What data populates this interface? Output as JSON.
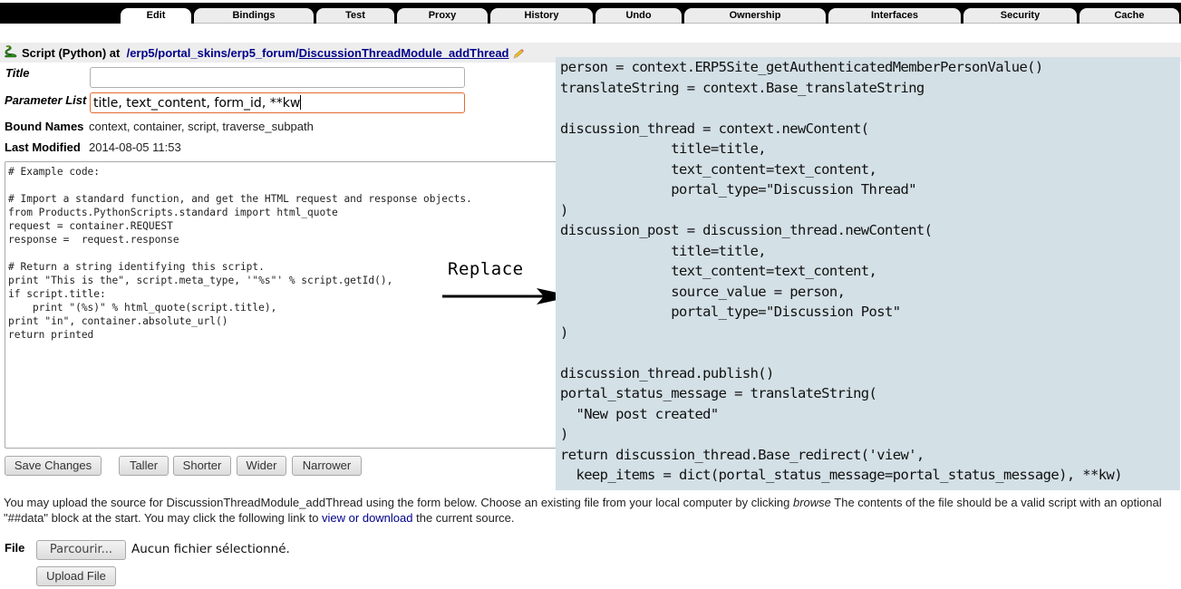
{
  "tabs": [
    {
      "label": "Edit",
      "active": true
    },
    {
      "label": "Bindings"
    },
    {
      "label": "Test"
    },
    {
      "label": "Proxy"
    },
    {
      "label": "History"
    },
    {
      "label": "Undo"
    },
    {
      "label": "Ownership"
    },
    {
      "label": "Interfaces"
    },
    {
      "label": "Security"
    },
    {
      "label": "Cache"
    }
  ],
  "header": {
    "meta_type": "Script (Python) at",
    "path_prefix": "/erp5/portal_skins/erp5_forum/",
    "path_segments": [
      "/erp5",
      "/portal_skins",
      "/erp5_forum",
      "/"
    ],
    "object_id": "DiscussionThreadModule_addThread"
  },
  "form": {
    "title_label": "Title",
    "title_value": "",
    "params_label": "Parameter List",
    "params_value": "title, text_content, form_id, **kw",
    "bound_label": "Bound Names",
    "bound_value": "context, container, script, traverse_subpath",
    "modified_label": "Last Modified",
    "modified_value": "2014-08-05 11:53"
  },
  "editor": {
    "content": "# Example code:\n\n# Import a standard function, and get the HTML request and response objects.\nfrom Products.PythonScripts.standard import html_quote\nrequest = container.REQUEST\nresponse =  request.response\n\n# Return a string identifying this script.\nprint \"This is the\", script.meta_type, '\"%s\"' % script.getId(),\nif script.title:\n    print \"(%s)\" % html_quote(script.title),\nprint \"in\", container.absolute_url()\nreturn printed"
  },
  "buttons": {
    "save": "Save Changes",
    "taller": "Taller",
    "shorter": "Shorter",
    "wider": "Wider",
    "narrower": "Narrower"
  },
  "annotation": {
    "label": "Replace",
    "replacement_code": "person = context.ERP5Site_getAuthenticatedMemberPersonValue()\ntranslateString = context.Base_translateString\n\ndiscussion_thread = context.newContent(\n              title=title,\n              text_content=text_content,\n              portal_type=\"Discussion Thread\"\n)\ndiscussion_post = discussion_thread.newContent(\n              title=title,\n              text_content=text_content,\n              source_value = person,\n              portal_type=\"Discussion Post\"\n)\n\ndiscussion_thread.publish()\nportal_status_message = translateString(\n  \"New post created\"\n)\nreturn discussion_thread.Base_redirect('view',\n  keep_items = dict(portal_status_message=portal_status_message), **kw)"
  },
  "upload": {
    "text_1": "You may upload the source for DiscussionThreadModule_addThread using the form below. Choose an existing file from your local computer by clicking ",
    "text_browse": "browse",
    "text_2": " The contents of the file should be a valid script with an optional \"##data\" block at the start. You may click the following link to ",
    "link": "view or download",
    "text_3": " the current source.",
    "file_label": "File",
    "browse_button": "Parcourir...",
    "file_status": "Aucun fichier sélectionné.",
    "upload_button": "Upload File"
  }
}
